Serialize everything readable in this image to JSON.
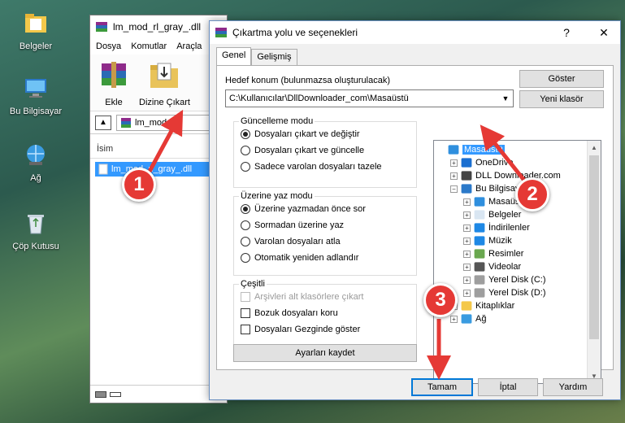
{
  "desktop": {
    "icons": [
      {
        "label": "Belgeler",
        "icon": "folder-documents-icon"
      },
      {
        "label": "Bu Bilgisayar",
        "icon": "computer-icon"
      },
      {
        "label": "Ağ",
        "icon": "network-icon"
      },
      {
        "label": "Çöp Kutusu",
        "icon": "recycle-bin-icon"
      }
    ]
  },
  "winrar": {
    "title": "lm_mod_rl_gray_.dll",
    "menu": [
      "Dosya",
      "Komutlar",
      "Araçla"
    ],
    "toolbar": {
      "add_label": "Ekle",
      "extract_label": "Dizine Çıkart"
    },
    "path": "lm_mod_rl_",
    "column_name": "İsim",
    "file": "lm_mod_rl_gray_.dll"
  },
  "dialog": {
    "title": "Çıkartma yolu ve seçenekleri",
    "help_glyph": "?",
    "close_glyph": "✕",
    "tabs": [
      "Genel",
      "Gelişmiş"
    ],
    "destination_label": "Hedef konum (bulunmazsa oluşturulacak)",
    "destination_value": "C:\\Kullanıcılar\\DllDownloader_com\\Masaüstü",
    "show_button": "Göster",
    "new_folder_button": "Yeni klasör",
    "update_mode": {
      "title": "Güncelleme modu",
      "options": [
        "Dosyaları çıkart ve değiştir",
        "Dosyaları çıkart ve güncelle",
        "Sadece varolan dosyaları tazele"
      ],
      "selected": 0
    },
    "overwrite_mode": {
      "title": "Üzerine yaz modu",
      "options": [
        "Üzerine yazmadan önce sor",
        "Sormadan üzerine yaz",
        "Varolan dosyaları atla",
        "Otomatik yeniden adlandır"
      ],
      "selected": 0
    },
    "misc": {
      "title": "Çeşitli",
      "options": [
        "Arşivleri alt klasörlere çıkart",
        "Bozuk dosyaları koru",
        "Dosyaları Gezginde göster"
      ],
      "disabled": [
        true,
        false,
        false
      ]
    },
    "save_settings_button": "Ayarları kaydet",
    "tree": [
      {
        "label": "Masaüstü",
        "level": 0,
        "expander": "",
        "icon": "desktop-icon",
        "selected": true
      },
      {
        "label": "OneDrive",
        "level": 1,
        "expander": "+",
        "icon": "cloud-icon"
      },
      {
        "label": "DLL Downloader.com",
        "level": 1,
        "expander": "+",
        "icon": "user-folder-icon"
      },
      {
        "label": "Bu Bilgisayar",
        "level": 1,
        "expander": "−",
        "icon": "computer-icon"
      },
      {
        "label": "Masaüstü",
        "level": 2,
        "expander": "+",
        "icon": "desktop-icon"
      },
      {
        "label": "Belgeler",
        "level": 2,
        "expander": "+",
        "icon": "documents-icon"
      },
      {
        "label": "İndirilenler",
        "level": 2,
        "expander": "+",
        "icon": "download-icon"
      },
      {
        "label": "Müzik",
        "level": 2,
        "expander": "+",
        "icon": "music-icon"
      },
      {
        "label": "Resimler",
        "level": 2,
        "expander": "+",
        "icon": "pictures-icon"
      },
      {
        "label": "Videolar",
        "level": 2,
        "expander": "+",
        "icon": "video-icon"
      },
      {
        "label": "Yerel Disk (C:)",
        "level": 2,
        "expander": "+",
        "icon": "disk-icon"
      },
      {
        "label": "Yerel Disk (D:)",
        "level": 2,
        "expander": "+",
        "icon": "disk-icon"
      },
      {
        "label": "Kitaplıklar",
        "level": 1,
        "expander": "+",
        "icon": "library-icon"
      },
      {
        "label": "Ağ",
        "level": 1,
        "expander": "+",
        "icon": "network-icon"
      }
    ],
    "ok_button": "Tamam",
    "cancel_button": "İptal",
    "help_button": "Yardım"
  },
  "annotations": {
    "markers": [
      "1",
      "2",
      "3"
    ],
    "color": "#e53935"
  }
}
